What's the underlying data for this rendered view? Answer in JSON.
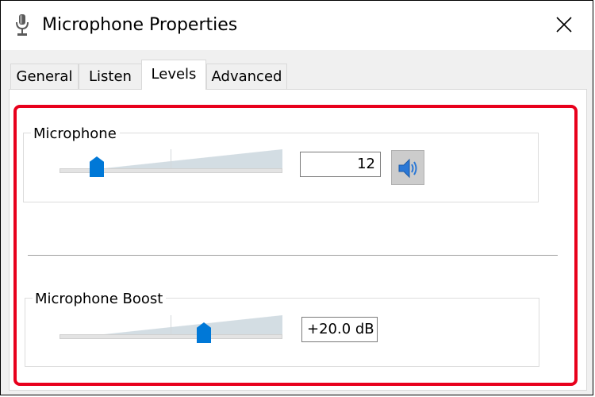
{
  "window": {
    "title": "Microphone Properties",
    "title_icon": "microphone-icon",
    "close_icon": "close-icon"
  },
  "tabs": [
    {
      "label": "General",
      "active": false
    },
    {
      "label": "Listen",
      "active": false
    },
    {
      "label": "Levels",
      "active": true
    },
    {
      "label": "Advanced",
      "active": false
    }
  ],
  "levels": {
    "microphone": {
      "label": "Microphone",
      "value": "12",
      "level_fraction": 0.12,
      "speaker_icon": "speaker-volume-icon"
    },
    "boost": {
      "label": "Microphone Boost",
      "value": "+20.0 dB",
      "level_fraction": 0.67
    }
  },
  "colors": {
    "highlight_border": "#e8001c",
    "slider_thumb": "#0078d7"
  }
}
